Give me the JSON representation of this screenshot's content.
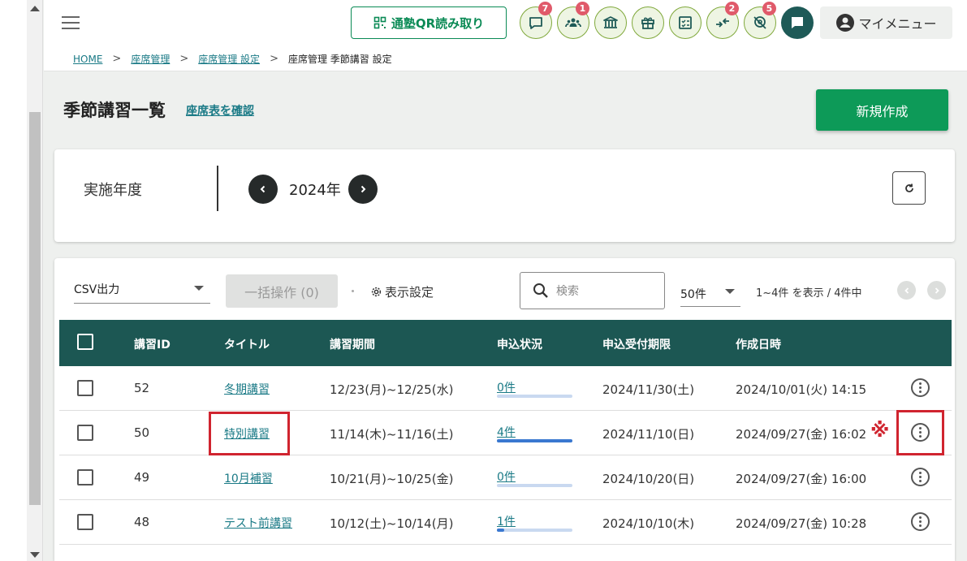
{
  "header": {
    "qr_label": "通塾QR読み取り",
    "icons": [
      {
        "name": "message-icon",
        "badge": "7"
      },
      {
        "name": "users-icon",
        "badge": "1"
      },
      {
        "name": "school-icon",
        "badge": ""
      },
      {
        "name": "gift-icon",
        "badge": ""
      },
      {
        "name": "checklist-icon",
        "badge": ""
      },
      {
        "name": "arrows-icon",
        "badge": "2"
      },
      {
        "name": "location-off-icon",
        "badge": "5"
      }
    ],
    "mymenu_label": "マイメニュー"
  },
  "breadcrumb": {
    "home": "HOME",
    "seat": "座席管理",
    "seat_settings": "座席管理 設定",
    "current": "座席管理 季節講習 設定"
  },
  "page": {
    "title": "季節講習一覧",
    "seat_link": "座席表を確認",
    "new_button": "新規作成"
  },
  "year_filter": {
    "label": "実施年度",
    "value": "2024年"
  },
  "toolbar": {
    "csv_label": "CSV出力",
    "bulk_label": "一括操作 (0)",
    "display_settings": "表示設定",
    "search_placeholder": "検索",
    "per_page": "50件",
    "range": "1~4件 を表示 / 4件中"
  },
  "table": {
    "headers": [
      "講習ID",
      "タイトル",
      "講習期間",
      "申込状況",
      "申込受付期限",
      "作成日時"
    ],
    "rows": [
      {
        "id": "52",
        "title": "冬期講習",
        "period": "12/23(月)~12/25(水)",
        "applied": "0件",
        "progress": 0.0,
        "deadline": "2024/11/30(土)",
        "created": "2024/10/01(火) 14:15"
      },
      {
        "id": "50",
        "title": "特別講習",
        "period": "11/14(木)~11/16(土)",
        "applied": "4件",
        "progress": 1.0,
        "deadline": "2024/11/10(日)",
        "created": "2024/09/27(金) 16:02"
      },
      {
        "id": "49",
        "title": "10月補習",
        "period": "10/21(月)~10/25(金)",
        "applied": "0件",
        "progress": 0.0,
        "deadline": "2024/10/20(日)",
        "created": "2024/09/27(金) 16:00"
      },
      {
        "id": "48",
        "title": "テスト前講習",
        "period": "10/12(土)~10/14(月)",
        "applied": "1件",
        "progress": 0.1,
        "deadline": "2024/10/10(木)",
        "created": "2024/09/27(金) 10:28"
      }
    ]
  },
  "annotation": {
    "mark": "※",
    "color": "#d0242f"
  }
}
